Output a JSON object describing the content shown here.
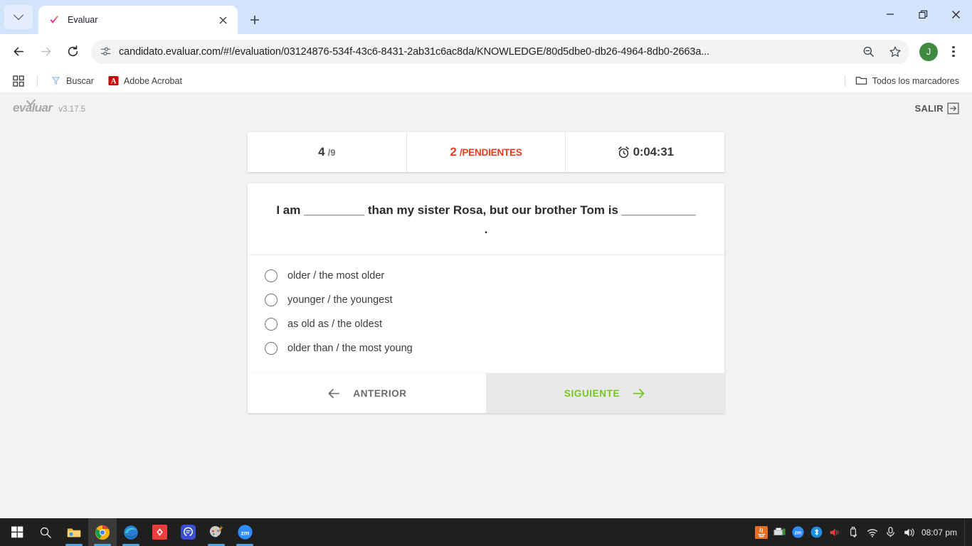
{
  "browser": {
    "tab": {
      "title": "Evaluar",
      "favicon": "evaluar-check-favicon"
    },
    "new_tab_label": "+",
    "url": "candidato.evaluar.com/#!/evaluation/03124876-534f-43c6-8431-2ab31c6ac8da/KNOWLEDGE/80d5dbe0-db26-4964-8db0-2663a...",
    "profile_initial": "J",
    "bookmarks": [
      {
        "label": "Buscar",
        "icon": "search-engine-icon"
      },
      {
        "label": "Adobe Acrobat",
        "icon": "adobe-acrobat-icon"
      }
    ],
    "all_bookmarks_label": "Todos los marcadores"
  },
  "app": {
    "logo_text": "evaluar",
    "version": "v3.17.5",
    "exit_label": "SALIR"
  },
  "status": {
    "question_current": "4",
    "question_total": "/9",
    "pending_count": "2",
    "pending_label": "/PENDIENTES",
    "timer": "0:04:31"
  },
  "question": {
    "text": "I am _________ than my sister Rosa, but our brother Tom is ___________ .",
    "options": [
      {
        "label": "older / the most older",
        "selected": false
      },
      {
        "label": "younger / the youngest",
        "selected": false
      },
      {
        "label": "as old as / the oldest",
        "selected": false
      },
      {
        "label": "older than / the most young",
        "selected": false
      }
    ]
  },
  "nav": {
    "prev_label": "ANTERIOR",
    "next_label": "SIGUIENTE"
  },
  "taskbar": {
    "clock": "08:07 pm",
    "items": [
      {
        "name": "start-button"
      },
      {
        "name": "search-button"
      },
      {
        "name": "file-explorer"
      },
      {
        "name": "chrome"
      },
      {
        "name": "edge"
      },
      {
        "name": "red-app"
      },
      {
        "name": "blue-chat-app"
      },
      {
        "name": "paint-app"
      },
      {
        "name": "zoom-app"
      }
    ]
  },
  "colors": {
    "accent_green": "#77c51f",
    "alert_red": "#f03b20",
    "chrome_tabstrip": "#d2e3fc",
    "page_bg": "#f2f2f2"
  }
}
